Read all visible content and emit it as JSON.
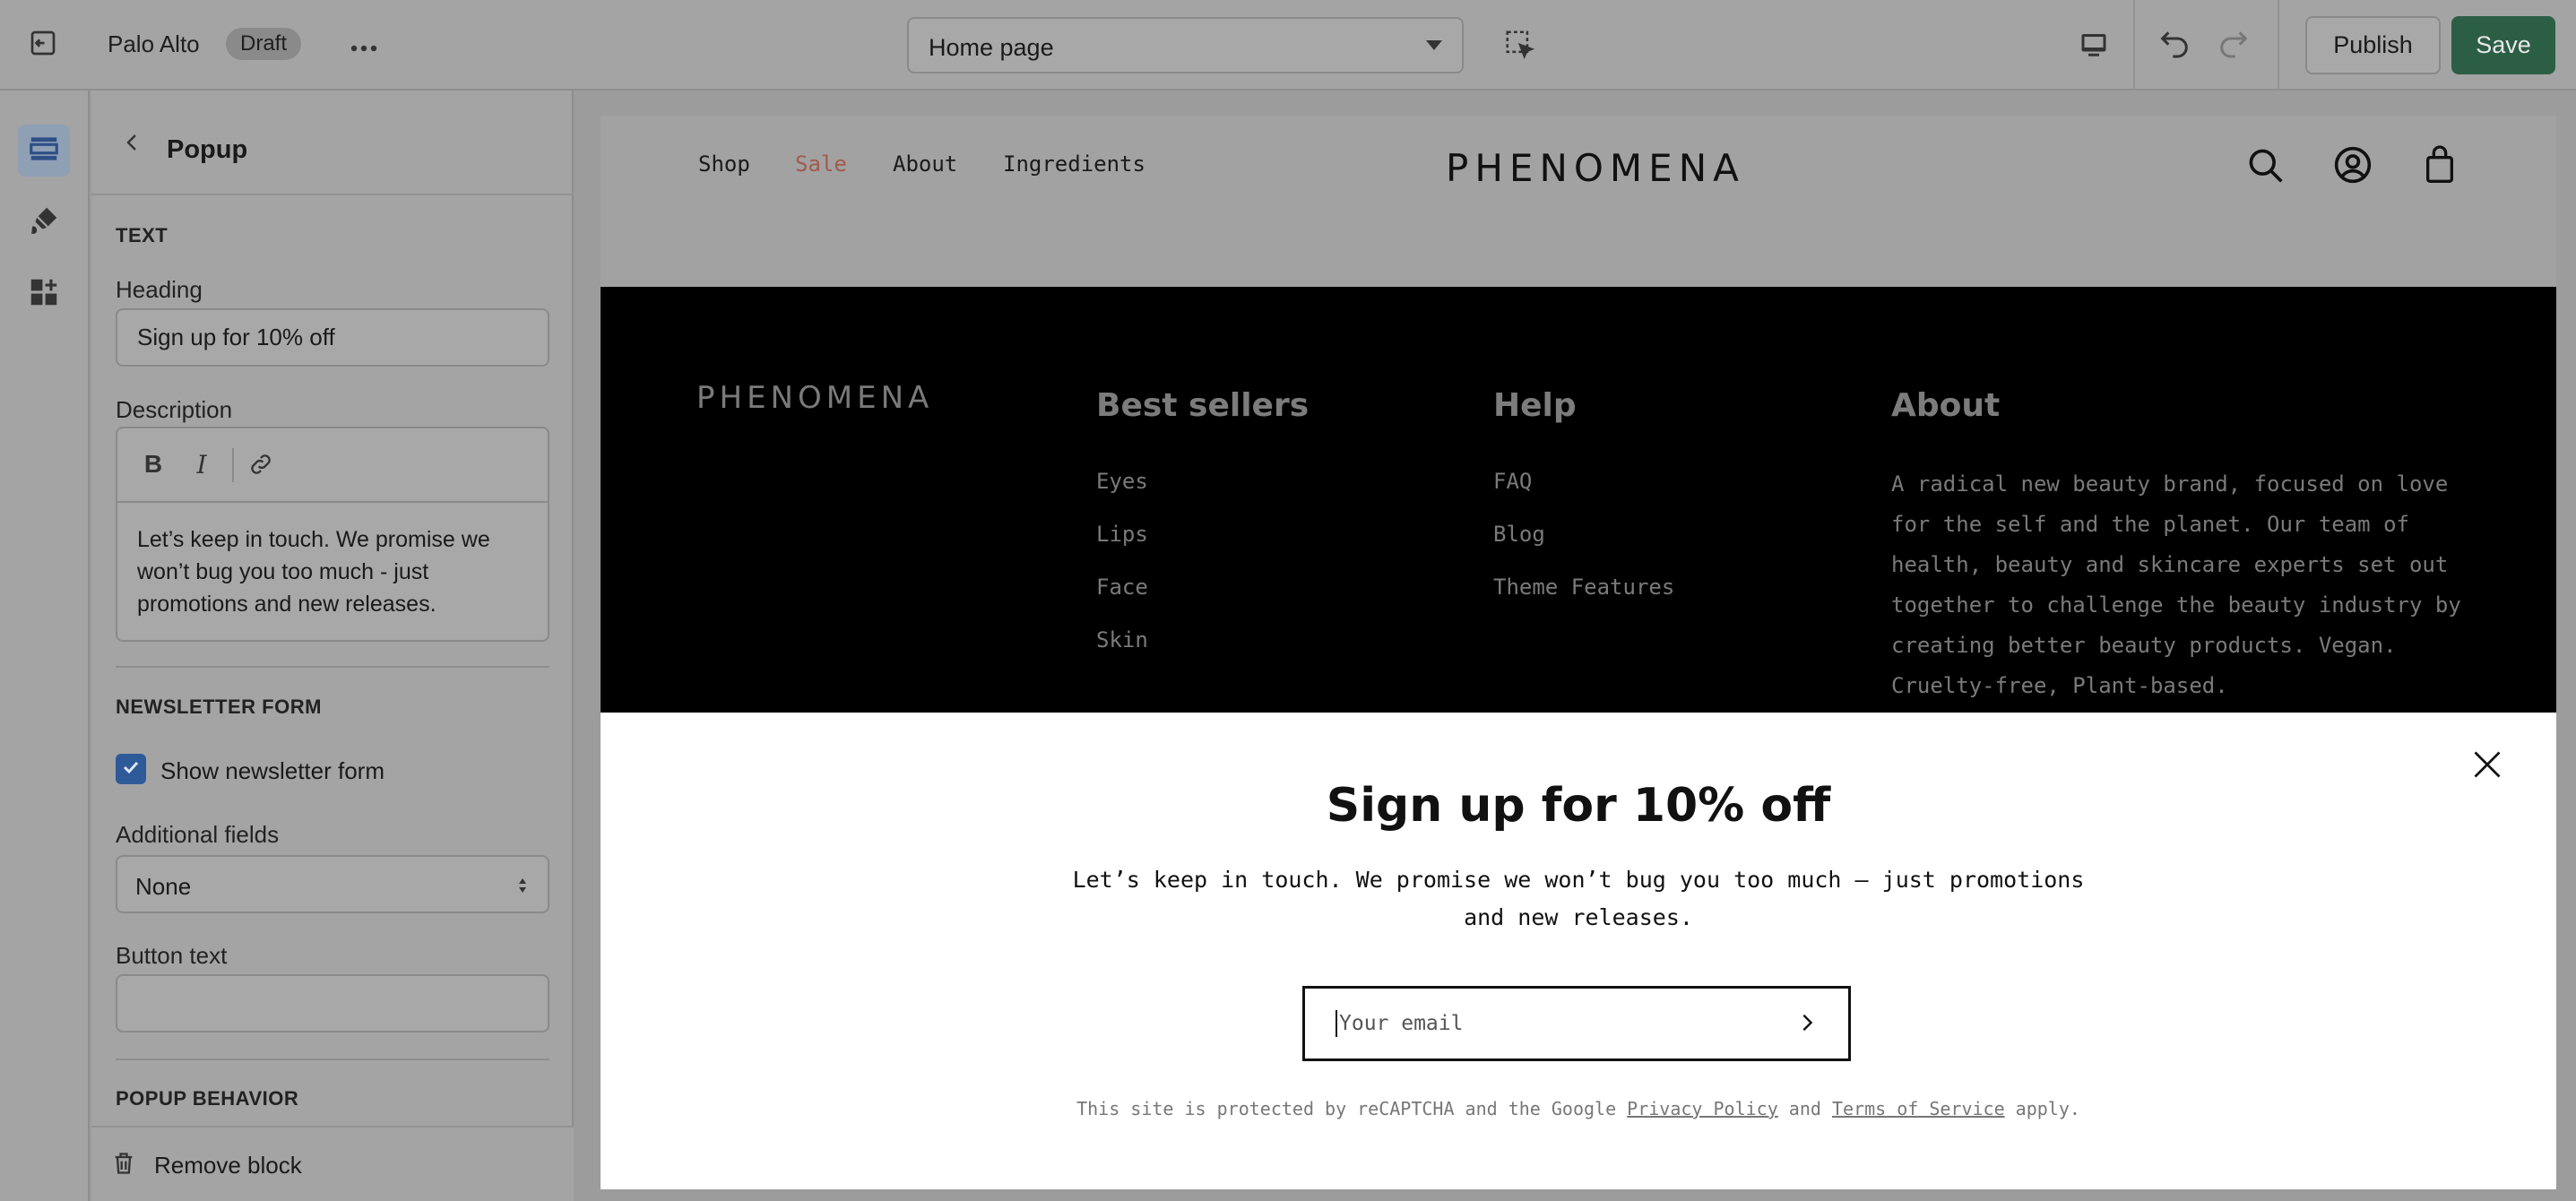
{
  "topbar": {
    "store_name": "Palo Alto",
    "status_badge": "Draft",
    "page_select": "Home page",
    "publish_label": "Publish",
    "save_label": "Save"
  },
  "panel": {
    "title": "Popup",
    "text_section": "TEXT",
    "heading_label": "Heading",
    "heading_value": "Sign up for 10% off",
    "description_label": "Description",
    "description_value": "Let’s keep in touch. We promise we won’t bug you too much - just promotions and new releases.",
    "newsletter_section": "NEWSLETTER FORM",
    "show_newsletter_label": "Show newsletter form",
    "show_newsletter_checked": true,
    "additional_fields_label": "Additional fields",
    "additional_fields_value": "None",
    "button_text_label": "Button text",
    "button_text_value": "",
    "popup_behavior_section": "POPUP BEHAVIOR",
    "remove_block_label": "Remove block"
  },
  "preview": {
    "nav": [
      "Shop",
      "Sale",
      "About",
      "Ingredients"
    ],
    "logo": "PHENOMENA",
    "footer": {
      "logo": "PHENOMENA",
      "columns": [
        {
          "heading": "Best sellers",
          "links": [
            "Eyes",
            "Lips",
            "Face",
            "Skin"
          ]
        },
        {
          "heading": "Help",
          "links": [
            "FAQ",
            "Blog",
            "Theme Features"
          ]
        },
        {
          "heading": "About",
          "text": "A radical new beauty brand, focused on love for the self and the planet. Our team of health, beauty and skincare experts set out together to challenge the beauty industry by creating better beauty products. Vegan. Cruelty-free, Plant-based."
        }
      ]
    },
    "popup": {
      "heading": "Sign up for 10% off",
      "description": "Let’s keep in touch. We promise we won’t bug you too much – just promotions and new releases.",
      "email_placeholder": "Your email",
      "legal_prefix": "This site is protected by reCAPTCHA and the Google ",
      "privacy_link": "Privacy Policy",
      "legal_and": " and ",
      "terms_link": "Terms of Service",
      "legal_suffix": " apply."
    }
  },
  "colors": {
    "accent_blue": "#2f5a9a",
    "save_green": "#2c5e46",
    "sale_red": "#a35a4e"
  }
}
